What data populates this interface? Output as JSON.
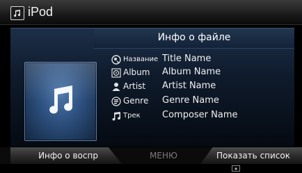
{
  "app": {
    "title": "iPod",
    "icon": "music-note-icon"
  },
  "panel": {
    "title": "Инфо о файле"
  },
  "info_rows": [
    {
      "icon": "title-icon",
      "label": "Название",
      "value": "Title Name"
    },
    {
      "icon": "album-icon",
      "label": "Album",
      "value": "Album Name"
    },
    {
      "icon": "artist-icon",
      "label": "Artist",
      "value": "Artist Name"
    },
    {
      "icon": "genre-icon",
      "label": "Genre",
      "value": "Genre Name"
    },
    {
      "icon": "track-icon",
      "label": "Трек",
      "value": "Composer Name"
    }
  ],
  "softkeys": {
    "left": "Инфо о воспр",
    "middle": "МЕНЮ",
    "right": "Показать список"
  },
  "colors": {
    "accent": "#2c4f7d",
    "text": "#ffffff",
    "disabled": "#7b7b7b"
  }
}
